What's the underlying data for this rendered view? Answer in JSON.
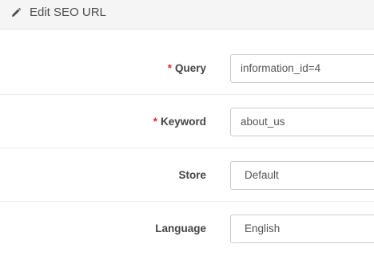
{
  "header": {
    "title": "Edit SEO URL",
    "icon": "pencil-icon"
  },
  "form": {
    "query": {
      "required_marker": "*",
      "label": "Query",
      "value": "information_id=4"
    },
    "keyword": {
      "required_marker": "*",
      "label": "Keyword",
      "value": "about_us"
    },
    "store": {
      "label": "Store",
      "value": "Default"
    },
    "language": {
      "label": "Language",
      "value": "English"
    }
  },
  "colors": {
    "required": "#e3282f",
    "heading_bg": "#f5f5f5"
  }
}
